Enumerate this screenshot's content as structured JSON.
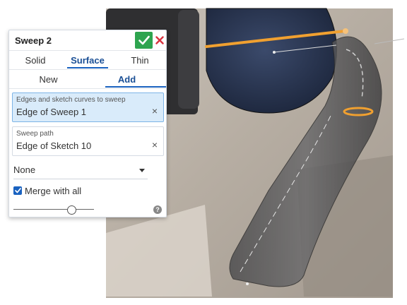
{
  "panel": {
    "title": "Sweep 2",
    "confirm_icon": "checkmark-icon",
    "cancel_icon": "close-x-icon",
    "type_tabs": [
      {
        "label": "Solid",
        "active": false
      },
      {
        "label": "Surface",
        "active": true
      },
      {
        "label": "Thin",
        "active": false
      }
    ],
    "op_tabs": [
      {
        "label": "New",
        "active": false
      },
      {
        "label": "Add",
        "active": true
      }
    ],
    "edges_field": {
      "label": "Edges and sketch curves to sweep",
      "value": "Edge of Sweep 1",
      "clear_icon": "close-icon"
    },
    "path_field": {
      "label": "Sweep path",
      "value": "Edge of Sketch 10",
      "clear_icon": "close-icon"
    },
    "profile_control": {
      "value": "None"
    },
    "merge": {
      "label": "Merge with all",
      "checked": true
    },
    "slider": {
      "level": 0.72
    },
    "help_label": "?"
  },
  "colors": {
    "accent": "#1a62c0",
    "confirm_green": "#2ea44f",
    "cancel_red": "#d9333f",
    "active_field_bg": "#d9ebfa",
    "highlight_orange": "#f0a030"
  }
}
